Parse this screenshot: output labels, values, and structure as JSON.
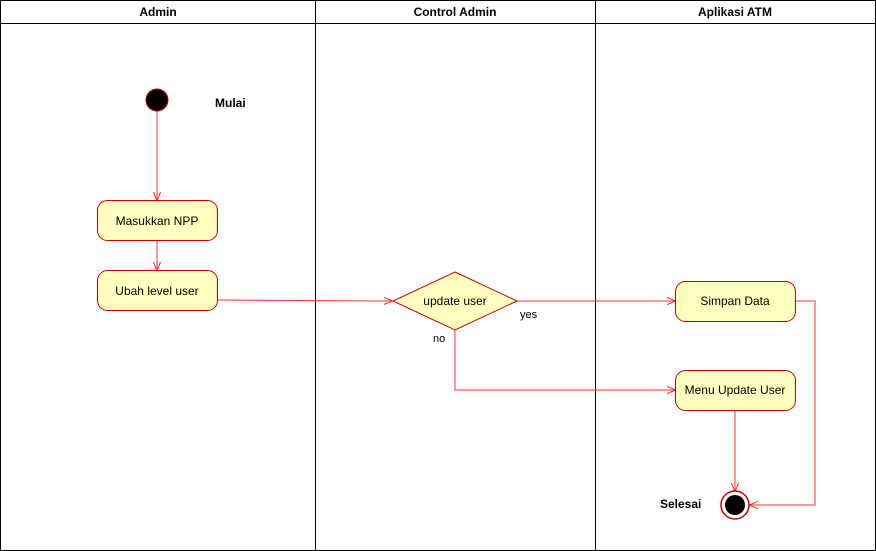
{
  "lanes": {
    "admin": "Admin",
    "control": "Control Admin",
    "atm": "Aplikasi ATM"
  },
  "nodes": {
    "start_label": "Mulai",
    "enter_npp": "Masukkan NPP",
    "change_level": "Ubah level user",
    "decision": "update user",
    "save_data": "Simpan Data",
    "update_menu": "Menu Update User",
    "end_label": "Selesai"
  },
  "edges": {
    "yes": "yes",
    "no": "no"
  },
  "colors": {
    "action_fill": "#ffffc0",
    "action_stroke": "#cc0000",
    "flow_line": "#ff3333",
    "node_fill": "#000000"
  }
}
